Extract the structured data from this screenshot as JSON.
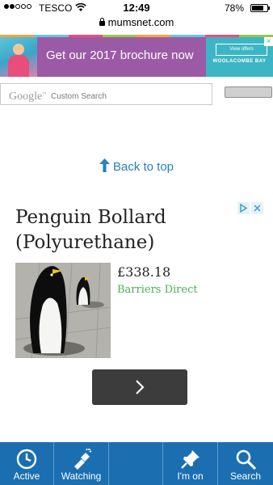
{
  "status_bar": {
    "carrier": "TESCO",
    "time": "12:49",
    "battery": "78%",
    "battery_level": 0.78,
    "signal_bars": 2,
    "signal_total": 5
  },
  "url_bar": {
    "domain": "mumsnet.com"
  },
  "banner_ad": {
    "headline": "Get our 2017 brochure now",
    "cta": "View offers",
    "brand": "WOOLACOMBE BAY",
    "brand_sub": "",
    "colors": {
      "background": "#9b5aa6",
      "logo_panel": "#3cb6c4"
    }
  },
  "search": {
    "logo": "Google",
    "label": "Custom Search",
    "value": "",
    "button_label": ""
  },
  "back_to_top": {
    "label": "Back to top",
    "icon": "arrow-up-icon"
  },
  "product_ad": {
    "title": "Penguin Bollard (Polyurethane)",
    "price": "£338.18",
    "seller": "Barriers Direct",
    "colors": {
      "seller": "#4caf50",
      "next_button": "#3c3c3c"
    },
    "adchoices_icons": [
      "adchoices-icon",
      "close-icon"
    ],
    "next_icon": "chevron-right-icon"
  },
  "bottom_nav": {
    "background": "#1b6fb0",
    "items": [
      {
        "id": "active",
        "label": "Active",
        "icon": "clock-icon"
      },
      {
        "id": "watching",
        "label": "Watching",
        "icon": "flashlight-icon"
      },
      {
        "id": "blank",
        "label": "",
        "icon": ""
      },
      {
        "id": "im-on",
        "label": "I'm on",
        "icon": "pin-icon"
      },
      {
        "id": "search",
        "label": "Search",
        "icon": "search-icon"
      }
    ]
  }
}
